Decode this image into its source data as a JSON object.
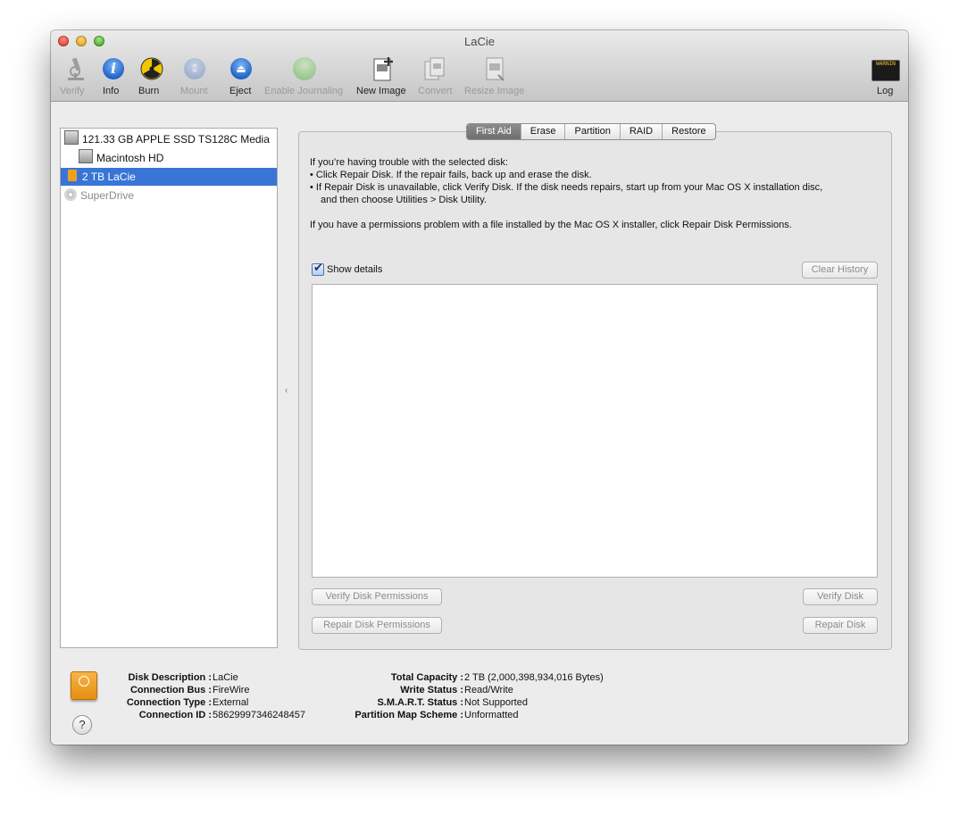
{
  "window": {
    "title": "LaCie"
  },
  "toolbar": {
    "verify": "Verify",
    "info": "Info",
    "burn": "Burn",
    "mount": "Mount",
    "eject": "Eject",
    "enable_journaling": "Enable Journaling",
    "new_image": "New Image",
    "convert": "Convert",
    "resize_image": "Resize Image",
    "log": "Log",
    "log_text": "WARNIN"
  },
  "sidebar": {
    "items": [
      {
        "label": "121.33 GB APPLE SSD TS128C Media",
        "icon": "internal-disk-icon"
      },
      {
        "label": "Macintosh HD",
        "icon": "volume-icon"
      },
      {
        "label": "2 TB LaCie",
        "icon": "external-disk-icon",
        "selected": true
      },
      {
        "label": "SuperDrive",
        "icon": "optical-drive-icon"
      }
    ]
  },
  "tabs": [
    "First Aid",
    "Erase",
    "Partition",
    "RAID",
    "Restore"
  ],
  "first_aid": {
    "intro": "If you’re having trouble with the selected disk:",
    "bullet1": "• Click Repair Disk. If the repair fails, back up and erase the disk.",
    "bullet2": "• If Repair Disk is unavailable, click Verify Disk. If the disk needs repairs, start up from your Mac OS X installation disc, and then choose Utilities > Disk Utility.",
    "permissions": "If you have a permissions problem with a file installed by the Mac OS X installer, click Repair Disk Permissions.",
    "show_details": "Show details",
    "clear_history": "Clear History",
    "verify_permissions": "Verify Disk Permissions",
    "repair_permissions": "Repair Disk Permissions",
    "verify_disk": "Verify Disk",
    "repair_disk": "Repair Disk"
  },
  "info": {
    "disk_description_label": "Disk Description :",
    "disk_description": "LaCie",
    "connection_bus_label": "Connection Bus :",
    "connection_bus": "FireWire",
    "connection_type_label": "Connection Type :",
    "connection_type": "External",
    "connection_id_label": "Connection ID :",
    "connection_id": "58629997346248457",
    "total_capacity_label": "Total Capacity :",
    "total_capacity": "2 TB (2,000,398,934,016 Bytes)",
    "write_status_label": "Write Status :",
    "write_status": "Read/Write",
    "smart_status_label": "S.M.A.R.T. Status :",
    "smart_status": "Not Supported",
    "partition_map_label": "Partition Map Scheme :",
    "partition_map": "Unformatted",
    "help": "?"
  }
}
